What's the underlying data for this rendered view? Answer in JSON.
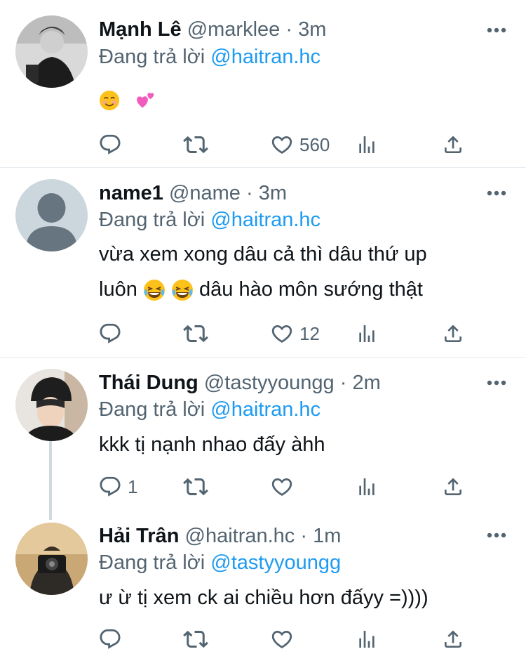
{
  "tweets": [
    {
      "name": "Mạnh Lê",
      "handle": "@marklee",
      "sep": "·",
      "time": "3m",
      "replying_prefix": "Đang trả lời",
      "replying_to": "@haitran.hc",
      "text_emoji": [
        "smiling-face-icon",
        "two-hearts-icon"
      ],
      "reply_count": "",
      "retweet_count": "",
      "like_count": "560"
    },
    {
      "name": "name1",
      "handle": "@name",
      "sep": "·",
      "time": "3m",
      "replying_prefix": "Đang trả lời",
      "replying_to": "@haitran.hc",
      "text_line1": "vừa xem xong dâu cả thì dâu thứ up",
      "text_line2_prefix": "luôn",
      "text_line2_suffix": "dâu hào môn sướng thật",
      "reply_count": "",
      "retweet_count": "",
      "like_count": "12"
    },
    {
      "name": "Thái Dung",
      "handle": "@tastyyoungg",
      "sep": "·",
      "time": "2m",
      "replying_prefix": "Đang trả lời",
      "replying_to": "@haitran.hc",
      "text": "kkk tị nạnh nhao đấy àhh",
      "reply_count": "1",
      "retweet_count": "",
      "like_count": ""
    },
    {
      "name": "Hải Trân",
      "handle": "@haitran.hc",
      "sep": "·",
      "time": "1m",
      "replying_prefix": "Đang trả lời",
      "replying_to": "@tastyyoungg",
      "text": "ư ừ tị xem ck ai chiều hơn đấyy =))))",
      "reply_count": "",
      "retweet_count": "",
      "like_count": ""
    }
  ],
  "colors": {
    "link": "#1d9bf0",
    "secondary": "#536471",
    "divider": "#e6ecf0",
    "thread_line": "#cfd9de"
  },
  "icons": [
    "more-icon",
    "reply-icon",
    "retweet-icon",
    "like-icon",
    "analytics-icon",
    "share-icon"
  ]
}
